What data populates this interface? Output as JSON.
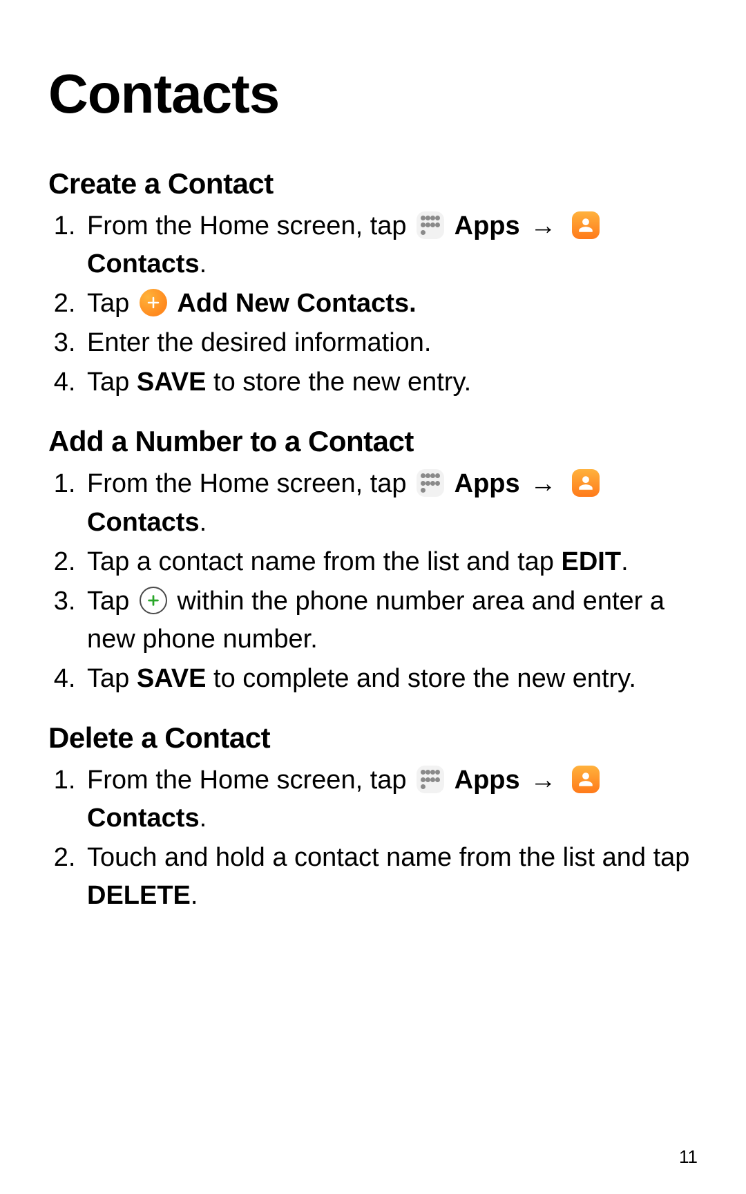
{
  "title": "Contacts",
  "page_number": "11",
  "sections": [
    {
      "heading": "Create a Contact",
      "steps": [
        {
          "parts": [
            {
              "t": "From the Home screen, tap "
            },
            {
              "icon": "apps"
            },
            {
              "t": " ",
              "b": false
            },
            {
              "t": "Apps",
              "b": true
            },
            {
              "t": " "
            },
            {
              "arrow": true
            },
            {
              "t": " "
            },
            {
              "icon": "contacts"
            },
            {
              "t": " "
            },
            {
              "t": "Contacts",
              "b": true
            },
            {
              "t": "."
            }
          ]
        },
        {
          "parts": [
            {
              "t": "Tap "
            },
            {
              "icon": "add-orange"
            },
            {
              "t": " "
            },
            {
              "t": "Add New Contacts.",
              "b": true
            }
          ]
        },
        {
          "parts": [
            {
              "t": "Enter the desired information."
            }
          ]
        },
        {
          "parts": [
            {
              "t": "Tap "
            },
            {
              "t": "SAVE",
              "b": true
            },
            {
              "t": " to store the new entry."
            }
          ]
        }
      ]
    },
    {
      "heading": "Add a Number to a Contact",
      "steps": [
        {
          "parts": [
            {
              "t": "From the Home screen, tap "
            },
            {
              "icon": "apps"
            },
            {
              "t": " "
            },
            {
              "t": "Apps",
              "b": true
            },
            {
              "t": " "
            },
            {
              "arrow": true
            },
            {
              "t": " "
            },
            {
              "icon": "contacts"
            },
            {
              "t": " "
            },
            {
              "t": "Contacts",
              "b": true
            },
            {
              "t": "."
            }
          ]
        },
        {
          "parts": [
            {
              "t": "Tap a contact name from the list and tap "
            },
            {
              "t": "EDIT",
              "b": true
            },
            {
              "t": "."
            }
          ]
        },
        {
          "parts": [
            {
              "t": "Tap "
            },
            {
              "icon": "plus-outline"
            },
            {
              "t": " within the phone number area and enter a new phone number."
            }
          ]
        },
        {
          "parts": [
            {
              "t": "Tap "
            },
            {
              "t": "SAVE",
              "b": true
            },
            {
              "t": " to complete and store the new entry."
            }
          ]
        }
      ]
    },
    {
      "heading": "Delete a Contact",
      "steps": [
        {
          "parts": [
            {
              "t": "From the Home screen, tap "
            },
            {
              "icon": "apps"
            },
            {
              "t": " "
            },
            {
              "t": "Apps",
              "b": true
            },
            {
              "t": " "
            },
            {
              "arrow": true
            },
            {
              "t": " "
            },
            {
              "icon": "contacts"
            },
            {
              "t": " "
            },
            {
              "t": "Contacts",
              "b": true
            },
            {
              "t": "."
            }
          ]
        },
        {
          "parts": [
            {
              "t": "Touch and hold a contact name from the list and tap "
            },
            {
              "t": "DELETE",
              "b": true
            },
            {
              "t": "."
            }
          ]
        }
      ]
    }
  ]
}
